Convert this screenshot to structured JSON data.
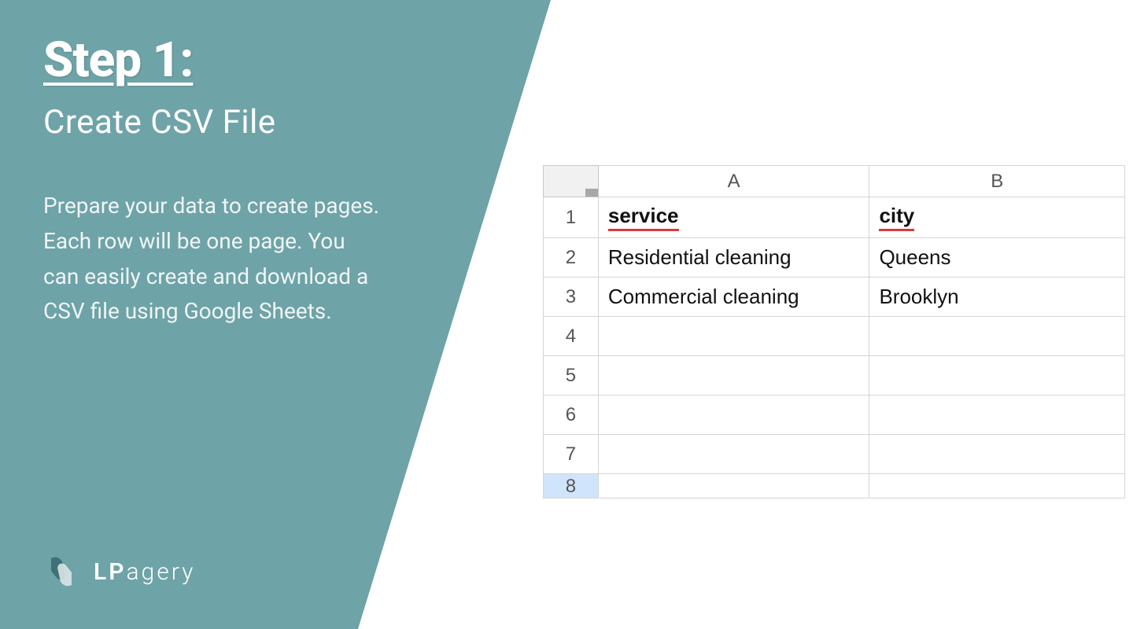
{
  "left": {
    "heading": "Step 1:",
    "subtitle": "Create CSV File",
    "description": "Prepare your data to create pages. Each row will be one page. You can easily create and download a CSV file using Google Sheets."
  },
  "brand": {
    "name_bold": "LP",
    "name_rest": "agery"
  },
  "sheet": {
    "columns": [
      "A",
      "B"
    ],
    "row_numbers": [
      "1",
      "2",
      "3",
      "4",
      "5",
      "6",
      "7",
      "8"
    ],
    "headers": {
      "a": "service",
      "b": "city"
    },
    "rows": [
      {
        "a": "Residential cleaning",
        "b": "Queens"
      },
      {
        "a": "Commercial cleaning",
        "b": "Brooklyn"
      },
      {
        "a": "",
        "b": ""
      },
      {
        "a": "",
        "b": ""
      },
      {
        "a": "",
        "b": ""
      },
      {
        "a": "",
        "b": ""
      }
    ]
  }
}
